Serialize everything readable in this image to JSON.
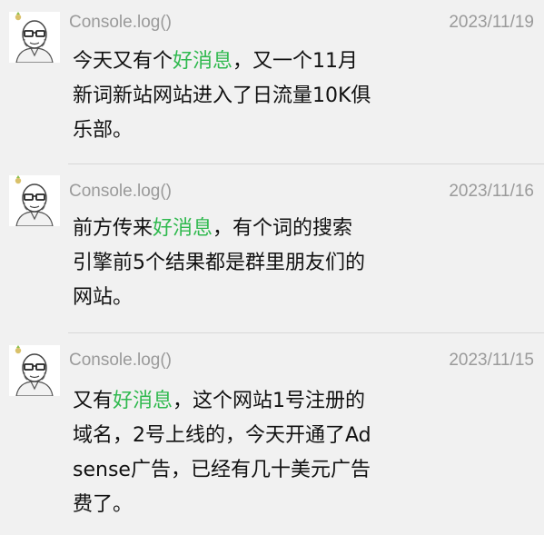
{
  "colors": {
    "highlight": "#2fb94e",
    "meta_text": "#9a9a9a",
    "body_text": "#111111",
    "background": "#f1f1f1"
  },
  "posts": [
    {
      "name": "Console.log()",
      "date": "2023/11/19",
      "avatar_icon": "bald-man-glasses-avatar",
      "before": "今天又有个",
      "highlight": "好消息",
      "after": "，又一个11月新词新站网站进入了日流量10K俱乐部。"
    },
    {
      "name": "Console.log()",
      "date": "2023/11/16",
      "avatar_icon": "bald-man-glasses-avatar",
      "before": "前方传来",
      "highlight": "好消息",
      "after": "，有个词的搜索引擎前5个结果都是群里朋友们的网站。"
    },
    {
      "name": "Console.log()",
      "date": "2023/11/15",
      "avatar_icon": "bald-man-glasses-avatar",
      "before": "又有",
      "highlight": "好消息",
      "after": "，这个网站1号注册的域名，2号上线的，今天开通了Adsense广告，已经有几十美元广告费了。"
    }
  ]
}
